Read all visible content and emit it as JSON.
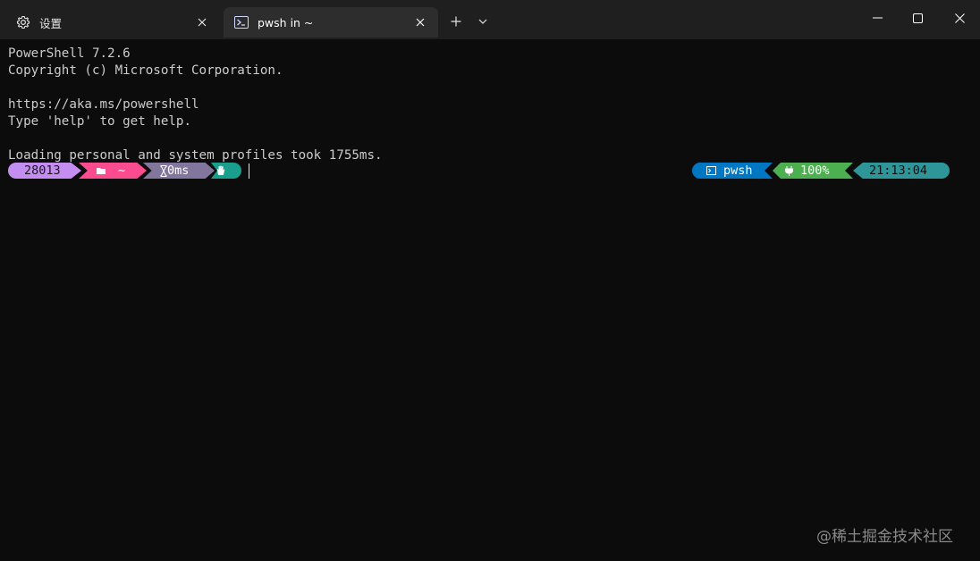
{
  "tabs": [
    {
      "title": "设置",
      "icon": "gear-icon"
    },
    {
      "title": "pwsh in ~",
      "icon": "powershell-icon"
    }
  ],
  "titlebar": {
    "new_tab": "+",
    "dropdown": "∨"
  },
  "terminal": {
    "lines": [
      "PowerShell 7.2.6",
      "Copyright (c) Microsoft Corporation.",
      "",
      "https://aka.ms/powershell",
      "Type 'help' to get help.",
      "",
      "Loading personal and system profiles took 1755ms."
    ]
  },
  "prompt": {
    "left": {
      "pid": "28013",
      "path_icon": "folder-icon",
      "path": "~",
      "time_icon": "hourglass-icon",
      "time": "0ms",
      "status_icon": "hand-icon"
    },
    "right": {
      "shell_icon": "terminal-icon",
      "shell": "pwsh",
      "battery_icon": "plug-icon",
      "battery": "100%",
      "clock": "21:13:04"
    }
  },
  "watermark": "@稀土掘金技术社区",
  "colors": {
    "background": "#0c0c0c",
    "titlebar": "#1f1f1f",
    "active_tab": "#2d2d2d",
    "pid_segment": "#c38ef0",
    "path_segment": "#fa4c8f",
    "time_segment": "#83769c",
    "status_segment": "#1a9e8e",
    "shell_segment": "#0077c2",
    "battery_segment": "#4caf50",
    "clock_segment": "#2e9599"
  }
}
